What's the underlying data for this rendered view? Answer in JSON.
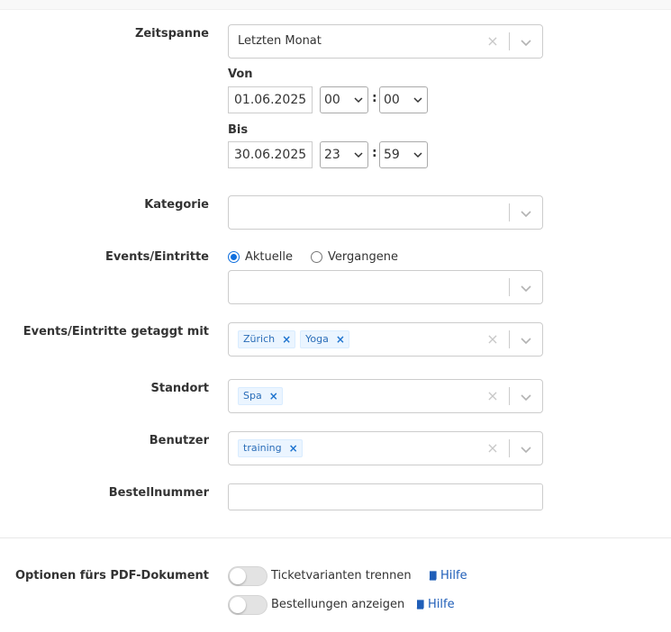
{
  "labels": {
    "zeitspanne": "Zeitspanne",
    "von": "Von",
    "bis": "Bis",
    "kategorie": "Kategorie",
    "events": "Events/Eintritte",
    "events_tagged": "Events/Eintritte getaggt mit",
    "standort": "Standort",
    "benutzer": "Benutzer",
    "bestellnummer": "Bestellnummer",
    "pdf_options": "Optionen fürs PDF-Dokument"
  },
  "zeitspanne": {
    "value": "Letzten Monat"
  },
  "von": {
    "date": "01.06.2025",
    "hour": "00",
    "minute": "00"
  },
  "bis": {
    "date": "30.06.2025",
    "hour": "23",
    "minute": "59"
  },
  "time_separator": ":",
  "events_radio": {
    "option1": "Aktuelle",
    "option2": "Vergangene",
    "selected": "Aktuelle"
  },
  "events_tagged": {
    "tags": [
      "Zürich",
      "Yoga"
    ]
  },
  "standort": {
    "tags": [
      "Spa"
    ]
  },
  "benutzer": {
    "tags": [
      "training"
    ]
  },
  "tag_remove": "×",
  "clear_glyph": "×",
  "bestellnummer": {
    "value": ""
  },
  "pdf": {
    "opt1": {
      "label": "Ticketvarianten trennen",
      "help": "Hilfe",
      "on": false
    },
    "opt2": {
      "label": "Bestellungen anzeigen",
      "help": "Hilfe",
      "on": false
    }
  },
  "colors": {
    "accent": "#0f6fde",
    "tag_bg": "#ebf5ff",
    "link": "#1f5eb8"
  }
}
